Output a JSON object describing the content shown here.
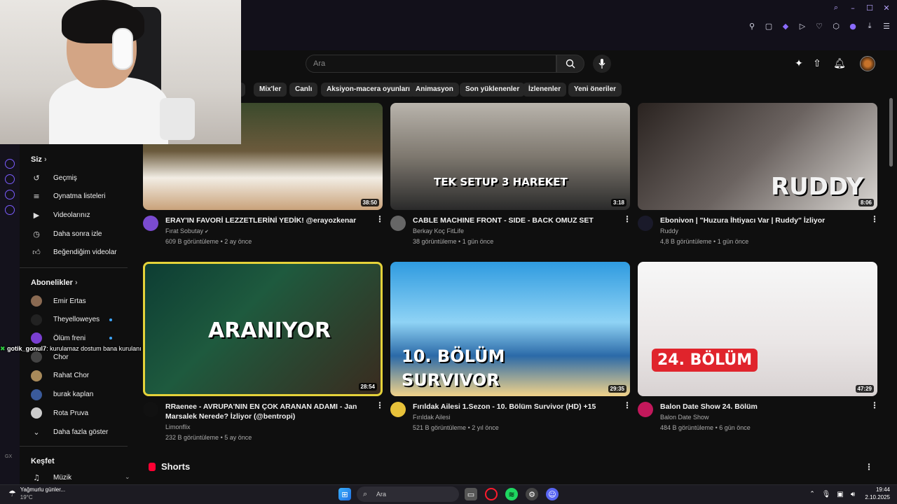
{
  "search": {
    "placeholder": "Ara"
  },
  "chips": [
    "r",
    "Mix'ler",
    "Canlı",
    "Aksiyon-macera oyunları",
    "Animasyon",
    "Son yüklenenler",
    "İzlenenler",
    "Yeni öneriler"
  ],
  "sidebar": {
    "you_heading": "Siz",
    "you_items": [
      {
        "label": "Geçmiş",
        "icon": "history-icon"
      },
      {
        "label": "Oynatma listeleri",
        "icon": "playlist-icon"
      },
      {
        "label": "Videolarınız",
        "icon": "video-icon"
      },
      {
        "label": "Daha sonra izle",
        "icon": "clock-icon"
      },
      {
        "label": "Beğendiğim videolar",
        "icon": "thumbs-up-icon"
      }
    ],
    "subs_heading": "Abonelikler",
    "subs": [
      {
        "label": "Emir Ertas",
        "live": false,
        "color": "#8a6a52"
      },
      {
        "label": "Theyelloweyes",
        "live": true,
        "color": "#222222"
      },
      {
        "label": "Ölüm freni",
        "live": true,
        "color": "#7a3fd0"
      },
      {
        "label": "Chor",
        "live": false,
        "color": "#444444"
      },
      {
        "label": "Rahat Chor",
        "live": false,
        "color": "#a88a5a"
      },
      {
        "label": "burak kaplan",
        "live": false,
        "color": "#3a5a9a"
      },
      {
        "label": "Rota Pruva",
        "live": false,
        "color": "#cccccc"
      }
    ],
    "show_more": "Daha fazla göster",
    "explore_heading": "Keşfet",
    "explore_items": [
      {
        "label": "Müzik",
        "icon": "music-icon"
      }
    ]
  },
  "chat": {
    "user": "gotik_gonul7",
    "message": ": kurulamaz dostum bana kurulanı amına koyarım"
  },
  "videos": [
    {
      "title": "ERAY'IN FAVORİ LEZZETLERİNİ YEDİK! @erayozkenar",
      "channel": "Fırat Sobutay",
      "verified": true,
      "views": "609 B görüntüleme",
      "age": "2 ay önce",
      "duration": "38:50",
      "thumb_text": "",
      "avatar_color": "#7a4bd0"
    },
    {
      "title": "CABLE MACHINE FRONT - SIDE - BACK OMUZ SET",
      "channel": "Berkay Koç FitLife",
      "verified": false,
      "views": "38 görüntüleme",
      "age": "1 gün önce",
      "duration": "3:18",
      "thumb_text": "TEK SETUP 3 HAREKET",
      "avatar_color": "#666666"
    },
    {
      "title": "Ebonivon | \"Huzura İhtiyacı Var | Ruddy\" İzliyor",
      "channel": "Ruddy",
      "verified": false,
      "views": "4,8 B görüntüleme",
      "age": "1 gün önce",
      "duration": "8:06",
      "thumb_text": "RUDDY",
      "avatar_color": "#1a1a2a"
    },
    {
      "title": "RRaenee - AVRUPA'NIN EN ÇOK ARANAN ADAMI - Jan Marsalek Nerede? İzliyor (@bentropi)",
      "channel": "Limonflix",
      "verified": false,
      "views": "232 B görüntüleme",
      "age": "5 ay önce",
      "duration": "28:54",
      "thumb_text": "ARANIYOR",
      "avatar_color": "#111111"
    },
    {
      "title": "Fırıldak Ailesi 1.Sezon - 10. Bölüm Survivor (HD) +15",
      "channel": "Fırıldak Ailesi",
      "verified": false,
      "views": "521 B görüntüleme",
      "age": "2 yıl önce",
      "duration": "29:35",
      "thumb_text": "10. BÖLÜM SURVIVOR",
      "avatar_color": "#e8c23a"
    },
    {
      "title": "Balon Date Show 24. Bölüm",
      "channel": "Balon Date Show",
      "verified": false,
      "views": "484 B görüntüleme",
      "age": "6 gün önce",
      "duration": "47:29",
      "thumb_text": "24. BÖLÜM",
      "avatar_color": "#c2185b"
    }
  ],
  "shorts_heading": "Shorts",
  "taskbar": {
    "weather_line1": "Yağmurlu günler...",
    "weather_line2": "19°C",
    "search_label": "Ara",
    "time": "19:44",
    "date": "2.10.2025"
  },
  "colors": {
    "accent": "#7b5cff",
    "live": "#3ea6ff",
    "youtube_red": "#ff0033"
  }
}
